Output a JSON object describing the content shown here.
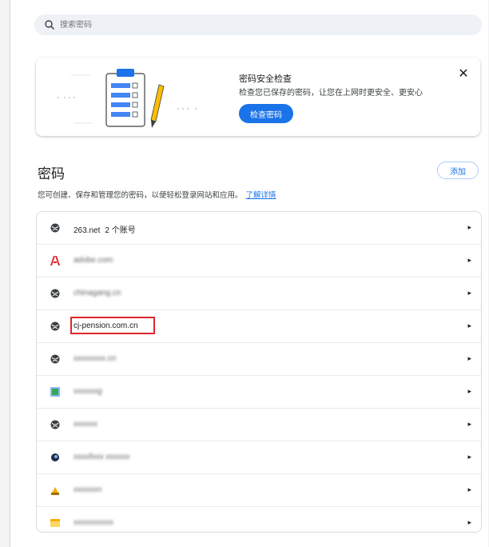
{
  "search": {
    "placeholder": "搜索密码"
  },
  "checkup_card": {
    "title": "密码安全检查",
    "description": "检查您已保存的密码，让您在上网时更安全、更安心",
    "button_label": "检查密码",
    "close_label": "✕"
  },
  "passwords": {
    "title": "密码",
    "add_label": "添加",
    "description": "您可创建、保存和管理您的密码，以便轻松登录网站和应用。",
    "learn_more": "了解详情"
  },
  "rows": [
    {
      "site": "263.net",
      "count": "2 个账号",
      "icon": "globe-icon"
    },
    {
      "site": "adobe.com",
      "icon": "adobe-icon"
    },
    {
      "site": "chinagang.cn",
      "icon": "globe-icon"
    },
    {
      "site": "cj-pension.com.cn",
      "icon": "globe-icon"
    },
    {
      "site": "xxxxxxxx.cn",
      "icon": "globe-icon"
    },
    {
      "site": "xxxxxxg",
      "icon": "image-icon"
    },
    {
      "site": "xxxxxx",
      "icon": "globe-icon"
    },
    {
      "site": "xxxxfxxx xxxxxx",
      "icon": "globe-dark-icon"
    },
    {
      "site": "xxxxxxn",
      "icon": "yellow-icon"
    },
    {
      "site": "xxxxxxxxxx",
      "icon": "note-icon"
    }
  ],
  "colors": {
    "accent": "#1a73e8",
    "highlight": "#e0252b"
  }
}
